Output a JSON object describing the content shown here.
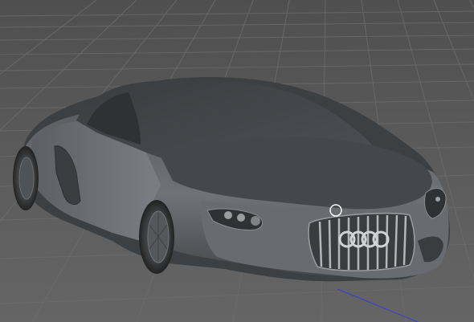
{
  "viewport": {
    "background_color": "#595959",
    "grid_color": "#6a6a6a",
    "model_shade_color": "#4a4c4f",
    "axis_color": "#3b3bd9",
    "cursor_icon": "circle-cursor-icon",
    "model_subject": "car-3d-model"
  }
}
